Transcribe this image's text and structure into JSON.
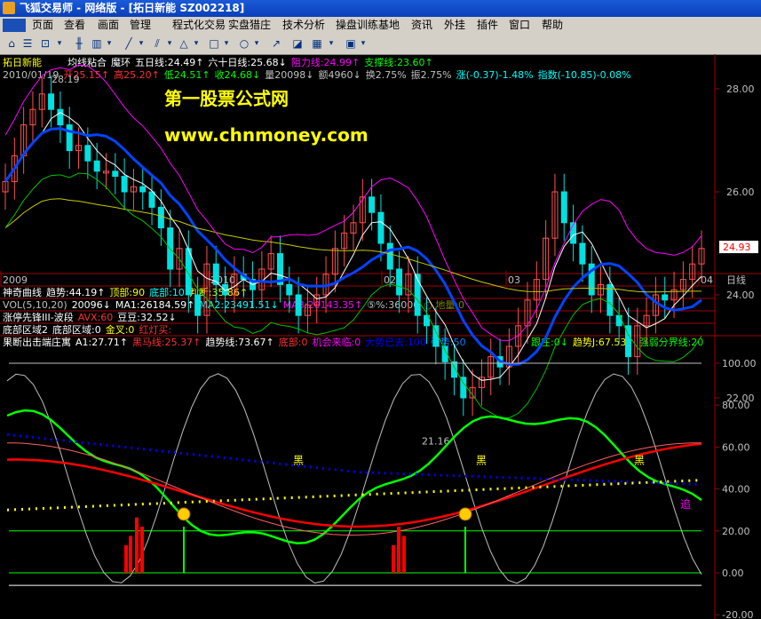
{
  "window": {
    "title": "飞狐交易师 - 网络版 - [拓日新能 SZ002218]"
  },
  "menu": [
    "页面",
    "查看",
    "画面",
    "管理",
    "程式化交易",
    "实盘猎庄",
    "技术分析",
    "操盘训练基地",
    "资讯",
    "外挂",
    "插件",
    "窗口",
    "帮助"
  ],
  "toolbar_icons": [
    "home-icon",
    "list-icon",
    "lock-icon",
    "dropdown-icon",
    "kline-icon",
    "bars-icon",
    "dropdown-icon",
    "line-draw-icon",
    "dropdown-icon",
    "parallel-icon",
    "dropdown-icon",
    "triangle-icon",
    "dropdown-icon",
    "rectangle-icon",
    "dropdown-icon",
    "circle-icon",
    "dropdown-icon",
    "arrow-icon",
    "eraser-icon",
    "color-icon",
    "dropdown-icon",
    "save-icon",
    "dropdown-icon"
  ],
  "main_panel": {
    "stock_name": "拓日新能",
    "indicators": [
      {
        "text": "均线粘合",
        "color": "#ffffff"
      },
      {
        "text": "魔环",
        "color": "#ffffff"
      },
      {
        "text": "五日线:24.49↑",
        "color": "#ffffff"
      },
      {
        "text": "六十日线:25.68↓",
        "color": "#ffffff"
      },
      {
        "text": "阻力线:24.99↑",
        "color": "#ff00ff"
      },
      {
        "text": "支撑线:23.60↑",
        "color": "#00ff00"
      }
    ],
    "ohlc": [
      {
        "text": "2010/01/19",
        "color": "#c0c0c0"
      },
      {
        "text": "开25.15↑",
        "color": "#ff3030"
      },
      {
        "text": "高25.20↑",
        "color": "#ff3030"
      },
      {
        "text": "低24.51↑",
        "color": "#00ff00"
      },
      {
        "text": "收24.68↓",
        "color": "#00ff00"
      },
      {
        "text": "量20098↓",
        "color": "#c0c0c0"
      },
      {
        "text": "额4960↓",
        "color": "#c0c0c0"
      },
      {
        "text": "换2.75%",
        "color": "#c0c0c0"
      },
      {
        "text": "振2.75%",
        "color": "#c0c0c0"
      },
      {
        "text": "涨(-0.37)-1.48%",
        "color": "#00ffff"
      },
      {
        "text": "指数(-10.85)-0.08%",
        "color": "#00ffff"
      }
    ],
    "watermark_1": "第一股票公式网",
    "watermark_2": "www.chnmoney.com",
    "high_label": "28.19",
    "low_label": "21.16",
    "price_axis": [
      "28.00",
      "26.00",
      "24.00",
      "22.00"
    ],
    "current_price": "24.93",
    "date_axis": [
      "2009",
      "2010",
      "02",
      "03",
      "04"
    ],
    "date_unit": "日线"
  },
  "sub_panels": {
    "shenqi": [
      {
        "text": "神奇曲线",
        "color": "#ffffff"
      },
      {
        "text": "趋势:44.19↑",
        "color": "#ffffff"
      },
      {
        "text": "顶部:90",
        "color": "#ffff00"
      },
      {
        "text": "底部:10",
        "color": "#00ffff"
      },
      {
        "text": "判断:35.86↑",
        "color": "#ffff00"
      }
    ],
    "vol": [
      {
        "text": "VOL(5,10,20)",
        "color": "#c0c0c0"
      },
      {
        "text": "20096↓",
        "color": "#ffffff"
      },
      {
        "text": "MA1:26184.59↑",
        "color": "#ffffff"
      },
      {
        "text": "MA2:23491.51↓",
        "color": "#00ffff"
      },
      {
        "text": "MA3:20143.35↑",
        "color": "#ff00ff"
      },
      {
        "text": "⑤%:36000",
        "color": "#c0c0c0"
      },
      {
        "text": "○ 地量:0",
        "color": "#808000"
      }
    ],
    "zhangting": [
      {
        "text": "涨停先锋III-波段",
        "color": "#ffffff"
      },
      {
        "text": "AVX:60",
        "color": "#ff3030"
      },
      {
        "text": "豆豆:32.52↓",
        "color": "#ffffff"
      }
    ],
    "dibu": [
      {
        "text": "底部区域2",
        "color": "#ffffff"
      },
      {
        "text": "底部区域:0",
        "color": "#ffffff"
      },
      {
        "text": "金叉:0",
        "color": "#ffff00"
      },
      {
        "text": "红灯买:",
        "color": "#ff3030"
      }
    ]
  },
  "bottom_panel": {
    "legend": [
      {
        "text": "果断出击端庄寓",
        "color": "#ffffff"
      },
      {
        "text": "A1:27.71↑",
        "color": "#ffffff"
      },
      {
        "text": "黑马线:25.37↑",
        "color": "#ff3030"
      },
      {
        "text": "趋势线:73.67↑",
        "color": "#ffffff"
      },
      {
        "text": "底部:0",
        "color": "#ff3030"
      },
      {
        "text": "机会来临:0",
        "color": "#ff00ff"
      },
      {
        "text": "大势已去:100",
        "color": "#0000ff"
      },
      {
        "text": "强势:50",
        "color": "#0080ff"
      },
      {
        "text": "跟庄:0↓",
        "color": "#00ff00"
      },
      {
        "text": "趋势J:67.53↑",
        "color": "#ffff00"
      },
      {
        "text": "强弱分界线:20",
        "color": "#00ff00"
      }
    ],
    "axis": [
      "100.00",
      "80.00",
      "60.00",
      "40.00",
      "20.00",
      "0.00",
      "-20.00"
    ],
    "hei_label": "黑",
    "zhui_label": "追"
  }
}
